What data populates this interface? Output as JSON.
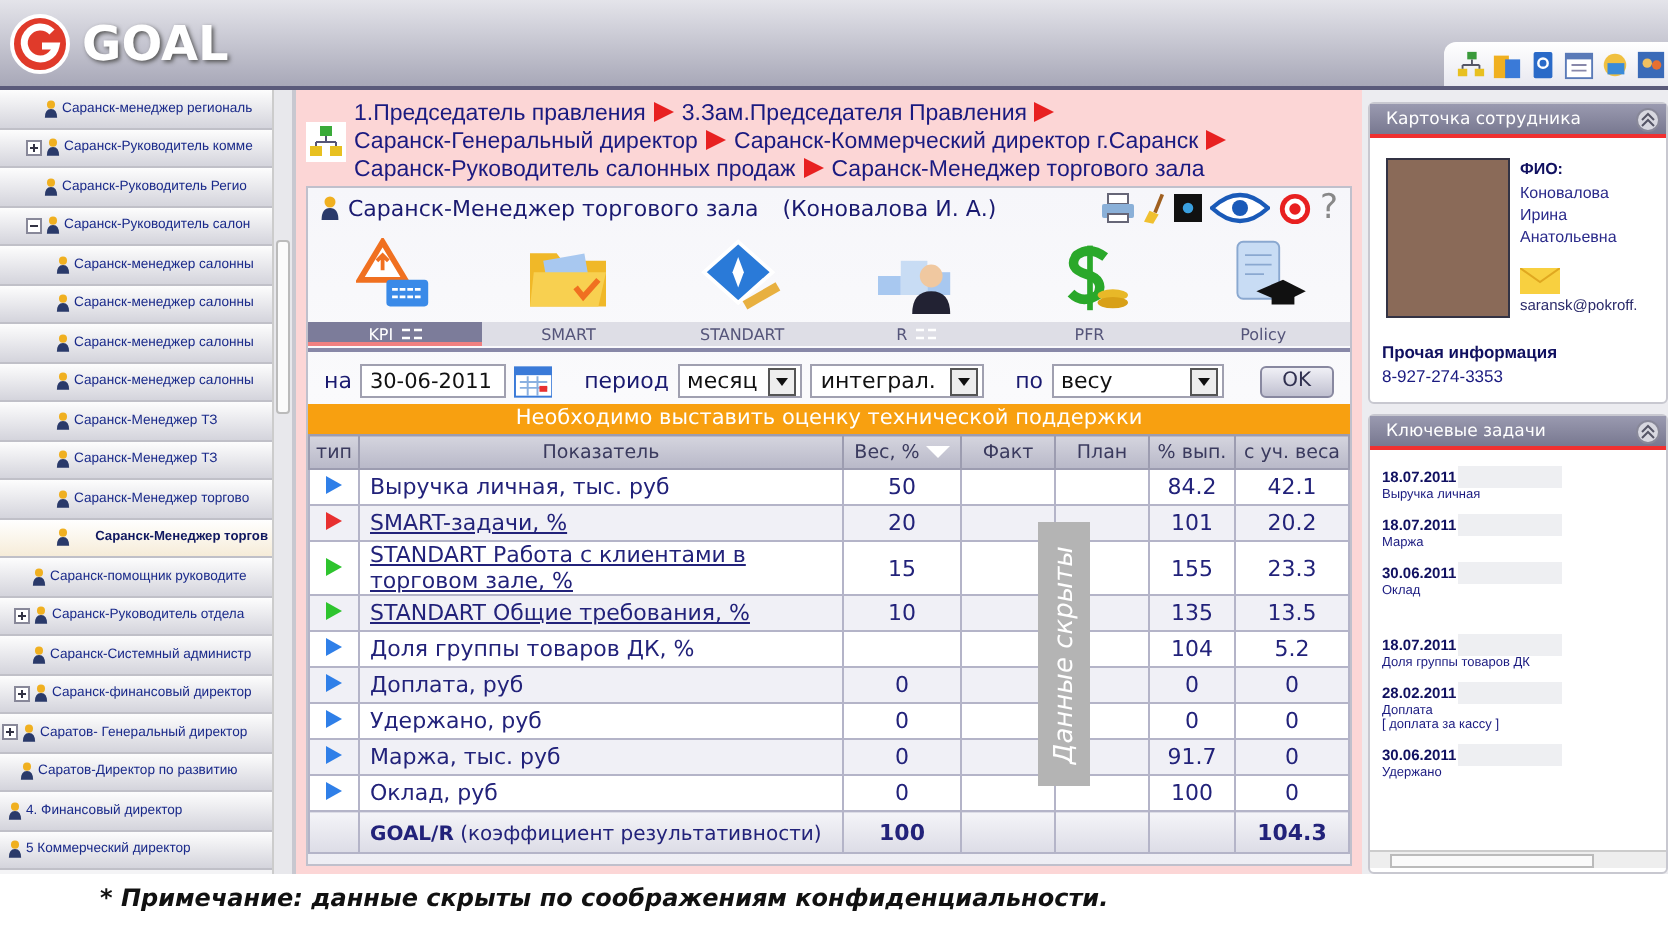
{
  "app": {
    "logo_text": "GOAL"
  },
  "sidebar": {
    "tree": [
      {
        "children": [
          {
            "children": [
              {
                "children": [
                  {
                    "label": "Саранск-менеджер региональ",
                    "selected": false
                  },
                  {
                    "label": "Саранск-Руководитель комме",
                    "selected": false,
                    "expanded": false
                  },
                  {
                    "label": "Саранск-Руководитель Регио",
                    "selected": false
                  },
                  {
                    "label": "Саранск-Руководитель салон",
                    "selected": false,
                    "expanded": true,
                    "children": [
                      {
                        "label": "Саранск-менеджер салонны",
                        "selected": false
                      },
                      {
                        "label": "Саранск-менеджер салонны",
                        "selected": false
                      },
                      {
                        "label": "Саранск-менеджер салонны",
                        "selected": false
                      },
                      {
                        "label": "Саранск-менеджер салонны",
                        "selected": false
                      },
                      {
                        "label": "Саранск-Менеджер ТЗ",
                        "selected": false
                      },
                      {
                        "label": "Саранск-Менеджер ТЗ",
                        "selected": false
                      },
                      {
                        "label": "Саранск-Менеджер торгово",
                        "selected": false
                      },
                      {
                        "label": "Саранск-Менеджер торгов",
                        "selected": true
                      }
                    ]
                  }
                ]
              },
              {
                "label": "Саранск-помощник руководите",
                "selected": false
              },
              {
                "label": "Саранск-Руководитель отдела",
                "selected": false,
                "expanded": false
              },
              {
                "label": "Саранск-Системный администр",
                "selected": false
              },
              {
                "label": "Саранск-финансовый директор",
                "selected": false,
                "expanded": false
              }
            ]
          },
          {
            "label": "Саратов- Генеральный директор",
            "selected": false,
            "expanded": false
          },
          {
            "label": "Саратов-Директор по развитию",
            "selected": false
          }
        ]
      },
      {
        "label": "4. Финансовый директор",
        "selected": false
      },
      {
        "label": "5 Коммерческий директор",
        "selected": false
      }
    ]
  },
  "breadcrumb": {
    "items": [
      "1.Председатель правления",
      "3.Зам.Председателя Правления",
      "Саранск-Генеральный директор",
      "Саранск-Коммерческий директор г.Саранск",
      "Саранск-Руководитель салонных продаж",
      "Саранск-Менеджер торгового зала"
    ]
  },
  "panel": {
    "title": "Саранск-Менеджер торгового зала",
    "person": "(Коновалова И. А.)",
    "help": "?",
    "modules": [
      {
        "label": "KPI",
        "selected": true,
        "list_icon": true
      },
      {
        "label": "SMART",
        "selected": false,
        "list_icon": false
      },
      {
        "label": "STANDART",
        "selected": false,
        "list_icon": false
      },
      {
        "label": "R",
        "selected": false,
        "list_icon": true
      },
      {
        "label": "PFR",
        "selected": false,
        "list_icon": false
      },
      {
        "label": "Policy",
        "selected": false,
        "list_icon": false
      }
    ],
    "filters": {
      "date_label": "на",
      "date": "30-06-2011",
      "period_label": "период",
      "period": "месяц",
      "mode": "интеграл.",
      "by_label": "по",
      "by": "весу",
      "ok": "OK"
    },
    "notice": "Необходимо выставить оценку технической поддержки",
    "table": {
      "columns": [
        "тип",
        "Показатель",
        "Вес, %",
        "Факт",
        "План",
        "% вып.",
        "с уч. веса"
      ],
      "rows": [
        {
          "color": "#2f7fe8",
          "kind": "text",
          "label": "Выручка личная, тыс. руб",
          "weight": "50",
          "done": "84.2",
          "weighted": "42.1"
        },
        {
          "color": "#e83030",
          "kind": "link",
          "label": "SMART-задачи, %",
          "weight": "20",
          "done": "101",
          "weighted": "20.2"
        },
        {
          "color": "#2ec42e",
          "kind": "link",
          "label": "STANDART Работа с клиентами в торговом зале, %",
          "weight": "15",
          "done": "155",
          "weighted": "23.3"
        },
        {
          "color": "#2ec42e",
          "kind": "link",
          "label": "STANDART Общие требования, %",
          "weight": "10",
          "done": "135",
          "weighted": "13.5"
        },
        {
          "color": "#2f7fe8",
          "kind": "text",
          "label": "Доля группы товаров ДК, %",
          "done": "104",
          "weighted": "5.2"
        },
        {
          "color": "#2f7fe8",
          "kind": "text",
          "label": "Доплата, руб",
          "weight": "0",
          "done": "0",
          "weighted": "0"
        },
        {
          "color": "#2f7fe8",
          "kind": "text",
          "label": "Удержано, руб",
          "weight": "0",
          "done": "0",
          "weighted": "0"
        },
        {
          "color": "#2f7fe8",
          "kind": "text",
          "label": "Маржа, тыс. руб",
          "weight": "0",
          "done": "91.7",
          "weighted": "0"
        },
        {
          "color": "#2f7fe8",
          "kind": "text",
          "label": "Оклад, руб",
          "weight": "0",
          "done": "100",
          "weighted": "0"
        }
      ],
      "total": {
        "label": "**GOAL/R** (коэффициент результативности)",
        "weight": "100",
        "weighted": "104.3"
      }
    },
    "overlay_note": "Данные скрыты"
  },
  "employee_card": {
    "title": "Карточка сотрудника",
    "fio_label": "ФИО:",
    "name_lines": [
      "Коновалова",
      "Ирина",
      "Анатольевна"
    ],
    "email": "saransk@pokroff.",
    "other_label": "Прочая информация",
    "phone": "8-927-274-3353"
  },
  "key_tasks": {
    "title": "Ключевые задачи",
    "items": [
      {
        "date": "18.07.2011",
        "name": "Выручка личная"
      },
      {
        "date": "18.07.2011",
        "name": "Маржа"
      },
      {
        "date": "30.06.2011",
        "name": "Оклад"
      },
      {
        "date": "18.07.2011",
        "name": "Доля группы товаров ДК"
      },
      {
        "date": "28.02.2011",
        "name": "Доплата",
        "note": "[ доплата за кассу ]"
      },
      {
        "date": "30.06.2011",
        "name": "Удержано"
      }
    ]
  },
  "footnote": "* Примечание: данные скрыты по соображениям конфиденциальности."
}
